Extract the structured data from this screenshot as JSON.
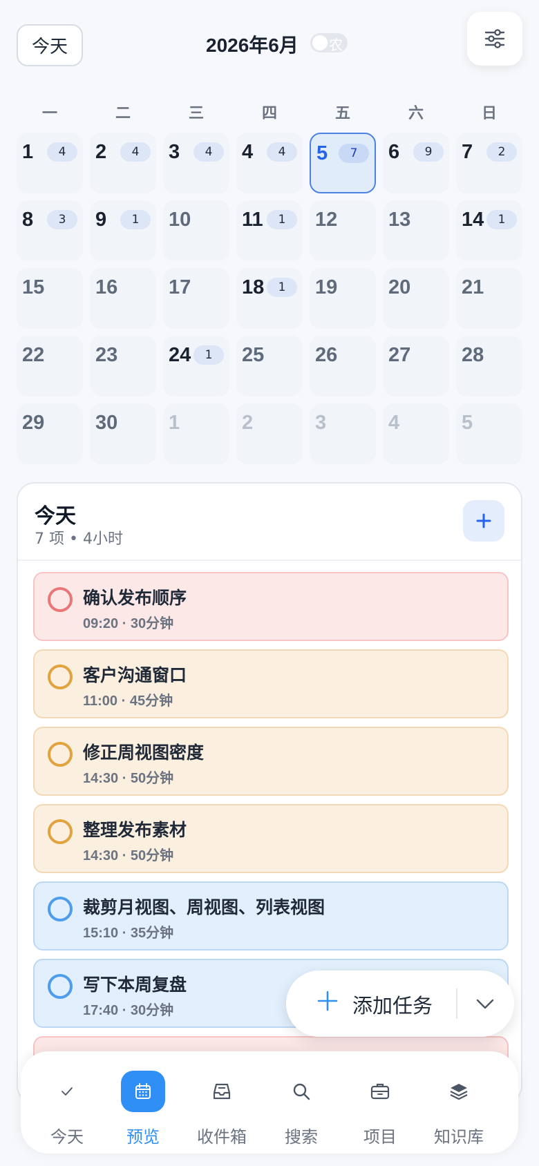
{
  "header": {
    "today_button": "今天",
    "month_title": "2026年6月",
    "lunar_label": "农"
  },
  "calendar": {
    "weekdays": [
      "一",
      "二",
      "三",
      "四",
      "五",
      "六",
      "日"
    ],
    "days": [
      {
        "day": "1",
        "count": "4"
      },
      {
        "day": "2",
        "count": "4"
      },
      {
        "day": "3",
        "count": "4"
      },
      {
        "day": "4",
        "count": "4"
      },
      {
        "day": "5",
        "count": "7",
        "selected": true
      },
      {
        "day": "6",
        "count": "9"
      },
      {
        "day": "7",
        "count": "2"
      },
      {
        "day": "8",
        "count": "3"
      },
      {
        "day": "9",
        "count": "1"
      },
      {
        "day": "10",
        "count": ""
      },
      {
        "day": "11",
        "count": "1"
      },
      {
        "day": "12",
        "count": ""
      },
      {
        "day": "13",
        "count": ""
      },
      {
        "day": "14",
        "count": "1"
      },
      {
        "day": "15",
        "count": ""
      },
      {
        "day": "16",
        "count": ""
      },
      {
        "day": "17",
        "count": ""
      },
      {
        "day": "18",
        "count": "1"
      },
      {
        "day": "19",
        "count": ""
      },
      {
        "day": "20",
        "count": ""
      },
      {
        "day": "21",
        "count": ""
      },
      {
        "day": "22",
        "count": ""
      },
      {
        "day": "23",
        "count": ""
      },
      {
        "day": "24",
        "count": "1"
      },
      {
        "day": "25",
        "count": ""
      },
      {
        "day": "26",
        "count": ""
      },
      {
        "day": "27",
        "count": ""
      },
      {
        "day": "28",
        "count": ""
      },
      {
        "day": "29",
        "count": ""
      },
      {
        "day": "30",
        "count": ""
      },
      {
        "day": "1",
        "count": "",
        "other_month": true
      },
      {
        "day": "2",
        "count": "",
        "other_month": true
      },
      {
        "day": "3",
        "count": "",
        "other_month": true
      },
      {
        "day": "4",
        "count": "",
        "other_month": true
      },
      {
        "day": "5",
        "count": "",
        "other_month": true
      }
    ]
  },
  "today_panel": {
    "title": "今天",
    "summary": "7 项 • 4小时",
    "add_label": "+",
    "tasks": [
      {
        "title": "确认发布顺序",
        "meta": "09:20 · 30分钟",
        "color": "red"
      },
      {
        "title": "客户沟通窗口",
        "meta": "11:00 · 45分钟",
        "color": "orange"
      },
      {
        "title": "修正周视图密度",
        "meta": "14:30 · 50分钟",
        "color": "orange"
      },
      {
        "title": "整理发布素材",
        "meta": "14:30 · 50分钟",
        "color": "orange"
      },
      {
        "title": "裁剪月视图、周视图、列表视图",
        "meta": "15:10 · 35分钟",
        "color": "blue"
      },
      {
        "title": "写下本周复盘",
        "meta": "17:40 · 30分钟",
        "color": "blue"
      },
      {
        "title": "",
        "meta": "",
        "color": "red"
      }
    ]
  },
  "fab": {
    "label": "添加任务",
    "plus_icon": "plus-icon",
    "chevron_icon": "chevron-down-icon"
  },
  "bottom_nav": {
    "items": [
      {
        "label": "今天",
        "icon": "check-icon",
        "active": false
      },
      {
        "label": "预览",
        "icon": "calendar-icon",
        "active": true
      },
      {
        "label": "收件箱",
        "icon": "inbox-icon",
        "active": false
      },
      {
        "label": "搜索",
        "icon": "search-icon",
        "active": false
      },
      {
        "label": "项目",
        "icon": "briefcase-icon",
        "active": false
      },
      {
        "label": "知识库",
        "icon": "layers-icon",
        "active": false
      }
    ]
  },
  "colors": {
    "accent": "#2f8ff5",
    "selected_day": "#2563eb",
    "red_task": "#fde8e8",
    "orange_task": "#fbefdf",
    "blue_task": "#e2effc"
  }
}
